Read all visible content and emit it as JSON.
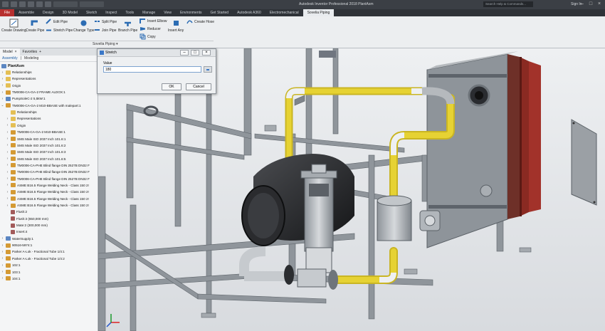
{
  "window": {
    "title": "Autodesk Inventor Professional 2018    PlantAsm",
    "search_placeholder": "Search Help & Commands...",
    "sign_in": "Sign In"
  },
  "ribbon_tabs": [
    "File",
    "Assemble",
    "Design",
    "3D Model",
    "Sketch",
    "Inspect",
    "Tools",
    "Manage",
    "View",
    "Environments",
    "Get Started",
    "Autodesk A360",
    "Electromechanical",
    "Sovelia Piping"
  ],
  "active_tab": "Sovelia Piping",
  "ribbon": {
    "create_drawing": "Create Drawing",
    "create_pipe": "Create Pipe",
    "edit_pipe": "Edit Pipe",
    "stretch_pipe": "Stretch Pipe",
    "change_type": "Change Type",
    "split_pipe": "Split Pipe",
    "join_pipe": "Join Pipe",
    "branch_pipe": "Branch Pipe",
    "insert_elbow": "Insert Elbow",
    "reducer": "Reducer",
    "copy": "Copy",
    "insert_any": "Insert Any",
    "create_hose": "Create Hose",
    "group_label": "Sovelia Piping ▾"
  },
  "browser": {
    "tab_model": "Model",
    "tab_favorites": "Favorites",
    "sub_assembly": "Assembly",
    "sub_modeling": "Modeling",
    "root": "PlantAsm",
    "nodes": [
      {
        "text": "Relationships",
        "level": 1,
        "icon": "folder",
        "expand": "›"
      },
      {
        "text": "Representations",
        "level": 1,
        "icon": "folder",
        "expand": "›"
      },
      {
        "text": "Origin",
        "level": 1,
        "icon": "folder",
        "expand": "›"
      },
      {
        "text": "TM0006-CA-GA-2 FRAME ALDOX:1",
        "level": 1,
        "icon": "part",
        "expand": "›"
      },
      {
        "text": "PumpSoleC-2 5,5kW:1",
        "level": 1,
        "icon": "asm",
        "expand": "›"
      },
      {
        "text": "TM0006-CA-GA-2 M10-BBASE with malepart:1",
        "level": 1,
        "icon": "part",
        "expand": "⌄"
      },
      {
        "text": "Relationships",
        "level": 2,
        "icon": "folder",
        "expand": ""
      },
      {
        "text": "Representations",
        "level": 2,
        "icon": "folder",
        "expand": "›"
      },
      {
        "text": "Origin",
        "level": 2,
        "icon": "folder",
        "expand": "›"
      },
      {
        "text": "TM0006-CA-GA-2 M10-BBASE:1",
        "level": 2,
        "icon": "part",
        "expand": "›"
      },
      {
        "text": "SMS Male ISO 2037 Inch 101.6:1",
        "level": 2,
        "icon": "part",
        "expand": "›"
      },
      {
        "text": "SMS Male ISO 2037 Inch 101.6:2",
        "level": 2,
        "icon": "part",
        "expand": "›"
      },
      {
        "text": "SMS Male ISO 2037 Inch 101.6:3",
        "level": 2,
        "icon": "part",
        "expand": "›"
      },
      {
        "text": "SMS Male ISO 2037 Inch 101.6:5",
        "level": 2,
        "icon": "part",
        "expand": "›"
      },
      {
        "text": "TM0006-CA-PHE Blind flange DIN 2527B DN32 F",
        "level": 2,
        "icon": "part",
        "expand": "›"
      },
      {
        "text": "TM0006-CA-PHE Blind flange DIN 2527B DN32 F",
        "level": 2,
        "icon": "part",
        "expand": "›"
      },
      {
        "text": "TM0006-CA-PHE Blind flange DIN 2527B DN32 F",
        "level": 2,
        "icon": "part",
        "expand": "›"
      },
      {
        "text": "ASME B16.5 Flange Welding Neck - Class 150 2!",
        "level": 2,
        "icon": "part",
        "expand": "›"
      },
      {
        "text": "ASME B16.5 Flange Welding Neck - Class 150 2!",
        "level": 2,
        "icon": "part",
        "expand": "›"
      },
      {
        "text": "ASME B16.5 Flange Welding Neck - Class 150 2!",
        "level": 2,
        "icon": "part",
        "expand": "›"
      },
      {
        "text": "ASME B16.5 Flange Welding Neck - Class 150 2!",
        "level": 2,
        "icon": "part",
        "expand": "›"
      },
      {
        "text": "Flush:2",
        "level": 2,
        "icon": "sk",
        "expand": ""
      },
      {
        "text": "Flush:3 (650,000 mm)",
        "level": 2,
        "icon": "sk",
        "expand": ""
      },
      {
        "text": "Mate:2 (300,000 mm)",
        "level": 2,
        "icon": "sk",
        "expand": ""
      },
      {
        "text": "Insert:4",
        "level": 2,
        "icon": "sk",
        "expand": ""
      },
      {
        "text": "WaterSupply:1",
        "level": 1,
        "icon": "asm",
        "expand": "›"
      },
      {
        "text": "90516-5974:1",
        "level": 1,
        "icon": "part",
        "expand": "›"
      },
      {
        "text": "Parker A-Lok - Fractional Tube 1/4:1",
        "level": 1,
        "icon": "part",
        "expand": "›"
      },
      {
        "text": "Parker A-Lok - Fractional Tube 1/4:2",
        "level": 1,
        "icon": "part",
        "expand": "›"
      },
      {
        "text": "102:1",
        "level": 1,
        "icon": "part",
        "expand": "›"
      },
      {
        "text": "103:1",
        "level": 1,
        "icon": "part",
        "expand": "›"
      },
      {
        "text": "104:1",
        "level": 1,
        "icon": "part",
        "expand": "›"
      }
    ]
  },
  "dialog": {
    "title": "Stretch",
    "value_label": "Value",
    "value": "180",
    "ok": "OK",
    "cancel": "Cancel"
  },
  "colors": {
    "pipe_yellow": "#e6d233",
    "frame_gray": "#8f959b",
    "plate_red": "#8a2a22",
    "ribbon_bg": "#eceef0",
    "file_tab": "#b7302f"
  }
}
